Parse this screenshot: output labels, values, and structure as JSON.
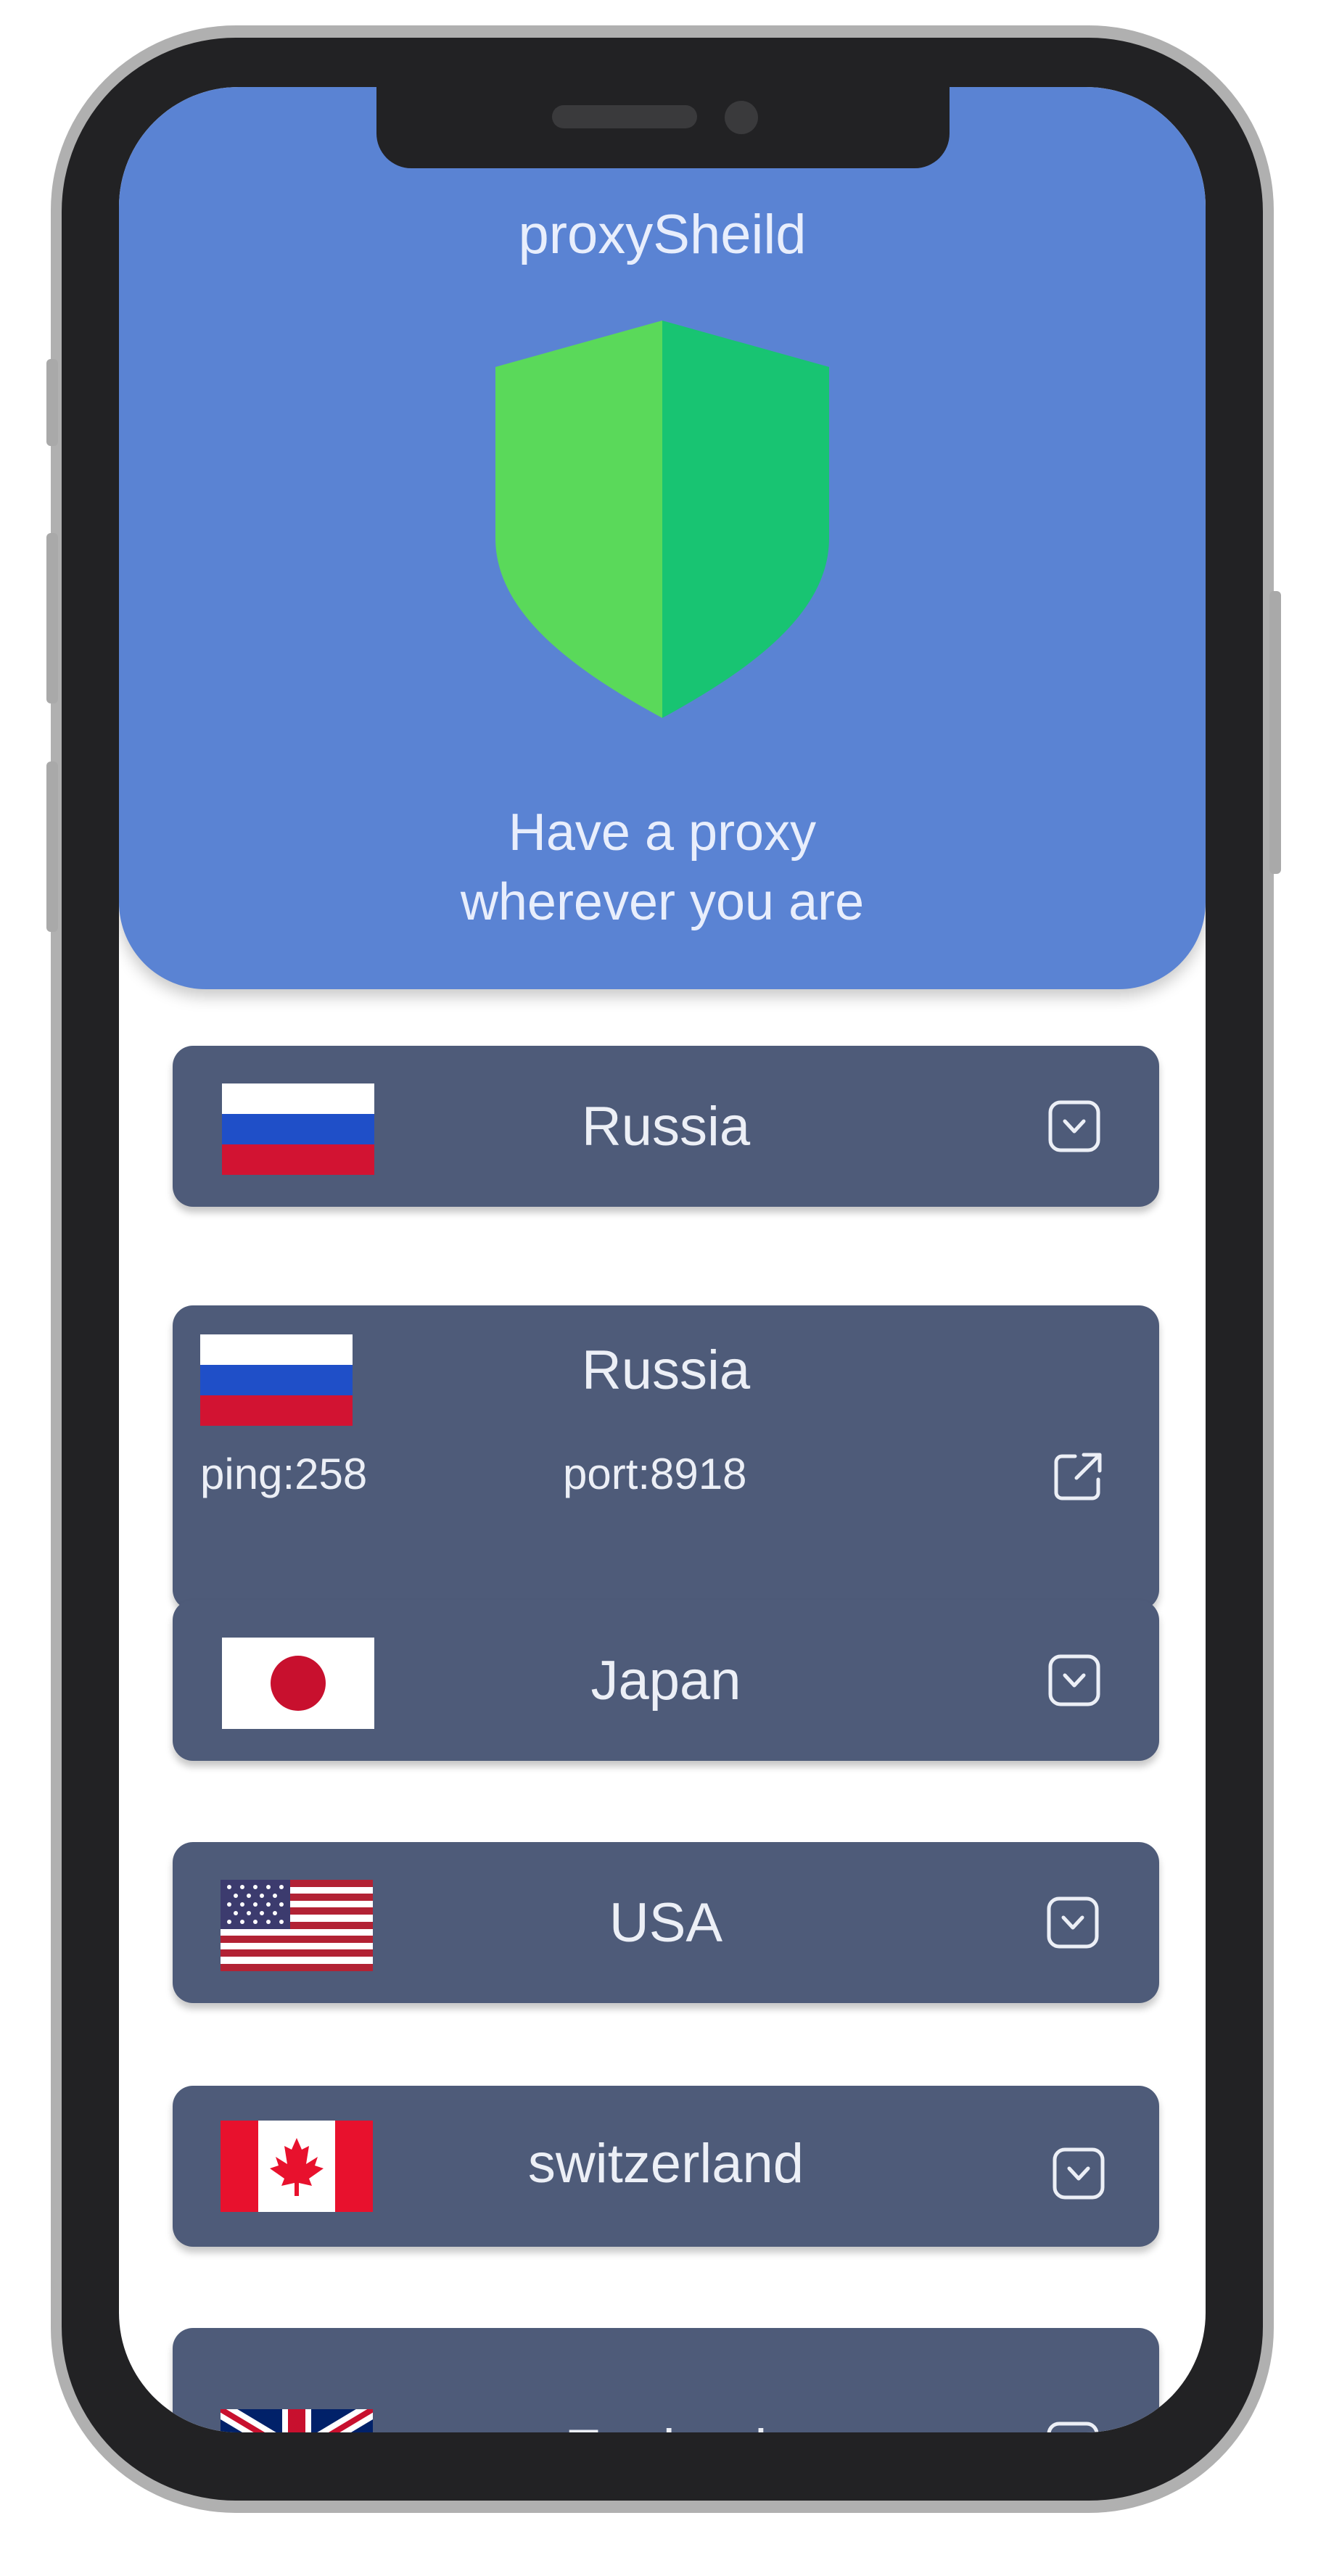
{
  "app": {
    "title": "proxySheild",
    "tagline_line1": "Have a proxy",
    "tagline_line2": "wherever you are"
  },
  "colors": {
    "hero_background": "#5a83d3",
    "card_background": "#4e5b79",
    "shield_left": "#5ad95a",
    "shield_right": "#18c472"
  },
  "proxies": [
    {
      "country": "Russia",
      "flag": "russia-flag",
      "expanded": false
    },
    {
      "country": "Russia",
      "flag": "russia-flag",
      "expanded": true,
      "ping_label": "ping:258",
      "port_label": "port:8918"
    },
    {
      "country": "Japan",
      "flag": "japan-flag",
      "expanded": false
    },
    {
      "country": "USA",
      "flag": "usa-flag",
      "expanded": false
    },
    {
      "country": "switzerland",
      "flag": "canada-flag",
      "expanded": false
    },
    {
      "country": "England",
      "flag": "uk-flag",
      "expanded": false
    }
  ]
}
